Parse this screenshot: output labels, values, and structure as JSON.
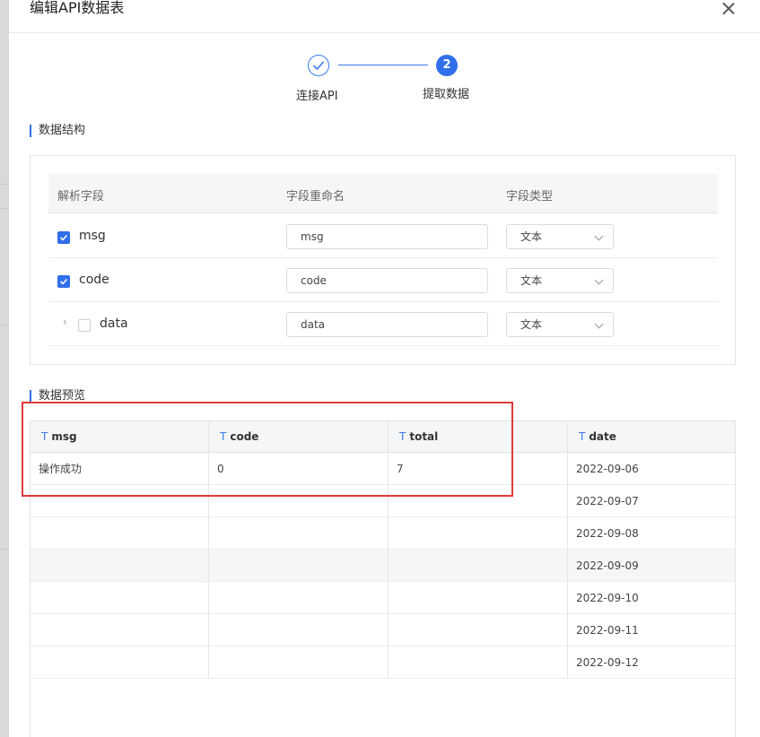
{
  "dialog": {
    "title": "编辑API数据表"
  },
  "steps": [
    {
      "label": "连接API",
      "state": "done",
      "icon": "check-icon"
    },
    {
      "label": "提取数据",
      "state": "active",
      "number": "2"
    }
  ],
  "structure": {
    "title": "数据结构",
    "headers": {
      "field": "解析字段",
      "rename": "字段重命名",
      "type": "字段类型"
    },
    "rows": [
      {
        "name": "msg",
        "checked": true,
        "rename": "msg",
        "type": "文本"
      },
      {
        "name": "code",
        "checked": true,
        "rename": "code",
        "type": "文本"
      },
      {
        "name": "data",
        "checked": false,
        "expandable": true,
        "rename": "data",
        "type": "文本"
      }
    ]
  },
  "preview": {
    "title": "数据预览",
    "type_icon": "T",
    "columns": [
      "msg",
      "code",
      "total",
      "date"
    ],
    "rows": [
      [
        "操作成功",
        "0",
        "7",
        "2022-09-06"
      ],
      [
        "",
        "",
        "",
        "2022-09-07"
      ],
      [
        "",
        "",
        "",
        "2022-09-08"
      ],
      [
        "",
        "",
        "",
        "2022-09-09"
      ],
      [
        "",
        "",
        "",
        "2022-09-10"
      ],
      [
        "",
        "",
        "",
        "2022-09-11"
      ],
      [
        "",
        "",
        "",
        "2022-09-12"
      ]
    ],
    "highlighted_row": 3
  },
  "colors": {
    "accent": "#2f6fe9",
    "highlight_box": "#e03a3a"
  }
}
